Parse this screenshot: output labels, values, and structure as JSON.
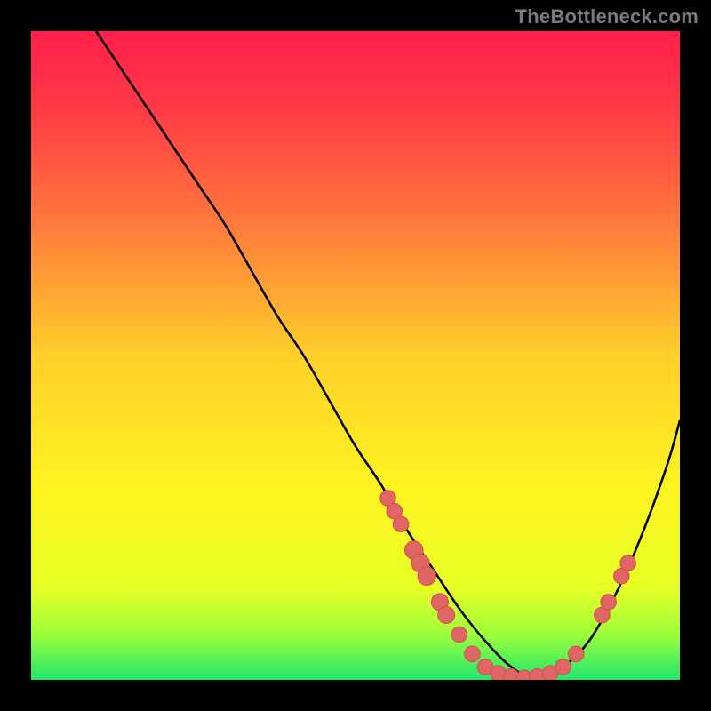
{
  "watermark": "TheBottleneck.com",
  "colors": {
    "background": "#000000",
    "curve": "#000000",
    "marker_fill": "#e06666",
    "marker_stroke": "#d84f4f",
    "gradient_stops": [
      {
        "offset": "0%",
        "color": "#ff1f4b"
      },
      {
        "offset": "12%",
        "color": "#ff3a45"
      },
      {
        "offset": "30%",
        "color": "#ff7b3c"
      },
      {
        "offset": "50%",
        "color": "#ffcf2a"
      },
      {
        "offset": "70%",
        "color": "#fff321"
      },
      {
        "offset": "86%",
        "color": "#e6ff26"
      },
      {
        "offset": "93%",
        "color": "#9cff3a"
      },
      {
        "offset": "100%",
        "color": "#20e66e"
      }
    ]
  },
  "chart_data": {
    "type": "line",
    "title": "",
    "xlabel": "",
    "ylabel": "",
    "xlim": [
      0,
      100
    ],
    "ylim": [
      0,
      100
    ],
    "grid": false,
    "legend": false,
    "series": [
      {
        "name": "bottleneck-curve",
        "x": [
          10,
          14,
          18,
          22,
          26,
          30,
          34,
          38,
          42,
          46,
          50,
          54,
          58,
          62,
          66,
          70,
          74,
          78,
          82,
          86,
          90,
          94,
          98,
          100
        ],
        "y": [
          100,
          94,
          88,
          82,
          76,
          70,
          63,
          56,
          50,
          43,
          36,
          30,
          23,
          17,
          11,
          6,
          2,
          0,
          2,
          6,
          13,
          22,
          33,
          40
        ]
      }
    ],
    "markers": [
      {
        "name": "left-cluster-1",
        "x": 55,
        "y": 28,
        "r": 1.2
      },
      {
        "name": "left-cluster-2",
        "x": 56,
        "y": 26,
        "r": 1.2
      },
      {
        "name": "left-cluster-3",
        "x": 57,
        "y": 24,
        "r": 1.2
      },
      {
        "name": "left-cluster-4",
        "x": 59,
        "y": 20,
        "r": 1.4
      },
      {
        "name": "left-cluster-5",
        "x": 60,
        "y": 18,
        "r": 1.4
      },
      {
        "name": "left-cluster-6",
        "x": 61,
        "y": 16,
        "r": 1.4
      },
      {
        "name": "left-cluster-7",
        "x": 63,
        "y": 12,
        "r": 1.3
      },
      {
        "name": "left-cluster-8",
        "x": 64,
        "y": 10,
        "r": 1.3
      },
      {
        "name": "left-cluster-9",
        "x": 66,
        "y": 7,
        "r": 1.2
      },
      {
        "name": "bottom-1",
        "x": 68,
        "y": 4,
        "r": 1.2
      },
      {
        "name": "bottom-2",
        "x": 70,
        "y": 2,
        "r": 1.2
      },
      {
        "name": "bottom-3",
        "x": 72,
        "y": 1,
        "r": 1.2
      },
      {
        "name": "bottom-4",
        "x": 74,
        "y": 0.5,
        "r": 1.2
      },
      {
        "name": "bottom-5",
        "x": 76,
        "y": 0.3,
        "r": 1.2
      },
      {
        "name": "bottom-6",
        "x": 78,
        "y": 0.5,
        "r": 1.2
      },
      {
        "name": "bottom-7",
        "x": 80,
        "y": 1,
        "r": 1.2
      },
      {
        "name": "bottom-8",
        "x": 82,
        "y": 2,
        "r": 1.2
      },
      {
        "name": "bottom-9",
        "x": 84,
        "y": 4,
        "r": 1.2
      },
      {
        "name": "right-1",
        "x": 88,
        "y": 10,
        "r": 1.2
      },
      {
        "name": "right-2",
        "x": 89,
        "y": 12,
        "r": 1.2
      },
      {
        "name": "right-3",
        "x": 91,
        "y": 16,
        "r": 1.2
      },
      {
        "name": "right-4",
        "x": 92,
        "y": 18,
        "r": 1.2
      }
    ]
  }
}
